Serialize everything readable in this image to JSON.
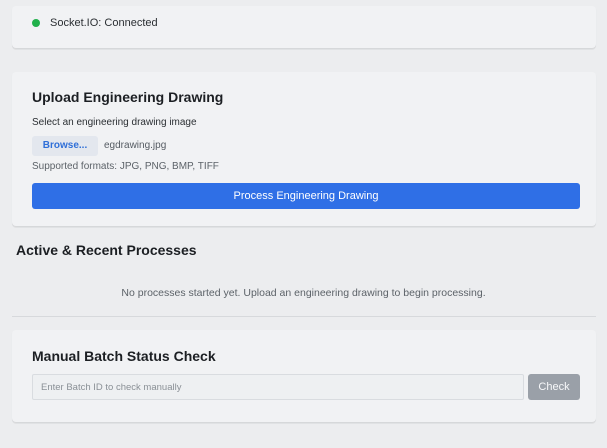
{
  "status": {
    "text": "Socket.IO: Connected",
    "dot_color": "#21b04b",
    "icon": "status-dot-icon"
  },
  "upload": {
    "title": "Upload Engineering Drawing",
    "label": "Select an engineering drawing image",
    "browse_label": "Browse...",
    "file_name": "egdrawing.jpg",
    "formats": "Supported formats: JPG, PNG, BMP, TIFF",
    "process_label": "Process Engineering Drawing",
    "accent_color": "#2f6fe6"
  },
  "processes": {
    "title": "Active & Recent Processes",
    "empty_message": "No processes started yet. Upload an engineering drawing to begin processing."
  },
  "manual": {
    "title": "Manual Batch Status Check",
    "input_value": "",
    "input_placeholder": "Enter Batch ID to check manually",
    "check_label": "Check",
    "check_color": "#9aa0a8"
  }
}
